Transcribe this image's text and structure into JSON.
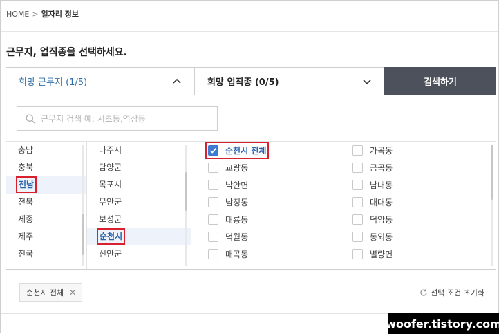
{
  "breadcrumb": {
    "home": "HOME",
    "separator": ">",
    "current": "일자리 정보"
  },
  "headline": "근무지, 업직종을 선택하세요.",
  "dropdowns": {
    "location": {
      "label": "희망 근무지 (1/5)",
      "state": "expanded"
    },
    "job": {
      "label": "희망 업직종 (0/5)",
      "state": "collapsed"
    }
  },
  "search_button": "검색하기",
  "location_search": {
    "placeholder": "근무지 검색 예: 서초동,역삼동",
    "value": ""
  },
  "regions": [
    {
      "label": "충남",
      "selected": false
    },
    {
      "label": "충북",
      "selected": false
    },
    {
      "label": "전남",
      "selected": true
    },
    {
      "label": "전북",
      "selected": false
    },
    {
      "label": "세종",
      "selected": false
    },
    {
      "label": "제주",
      "selected": false
    },
    {
      "label": "전국",
      "selected": false
    }
  ],
  "cities": [
    {
      "label": "나주시",
      "selected": false
    },
    {
      "label": "담양군",
      "selected": false
    },
    {
      "label": "목포시",
      "selected": false
    },
    {
      "label": "무안군",
      "selected": false
    },
    {
      "label": "보성군",
      "selected": false
    },
    {
      "label": "순천시",
      "selected": true
    },
    {
      "label": "신안군",
      "selected": false
    }
  ],
  "dongs_left": [
    {
      "label": "순천시 전체",
      "checked": true
    },
    {
      "label": "교량동",
      "checked": false
    },
    {
      "label": "낙안면",
      "checked": false
    },
    {
      "label": "남정동",
      "checked": false
    },
    {
      "label": "대룡동",
      "checked": false
    },
    {
      "label": "덕월동",
      "checked": false
    },
    {
      "label": "매곡동",
      "checked": false
    }
  ],
  "dongs_right": [
    {
      "label": "가곡동",
      "checked": false
    },
    {
      "label": "금곡동",
      "checked": false
    },
    {
      "label": "남내동",
      "checked": false
    },
    {
      "label": "대대동",
      "checked": false
    },
    {
      "label": "덕암동",
      "checked": false
    },
    {
      "label": "동외동",
      "checked": false
    },
    {
      "label": "별량면",
      "checked": false
    }
  ],
  "selected_chip": {
    "label": "순천시 전체",
    "remove_icon": "close-icon"
  },
  "reset_button": "선택 조건 초기화",
  "watermark": "woofer.tistory.com",
  "colors": {
    "accent": "#2a64a8",
    "search_button": "#4c515c",
    "highlight": "#d8202f",
    "checkbox_on": "#3e7ad1"
  }
}
